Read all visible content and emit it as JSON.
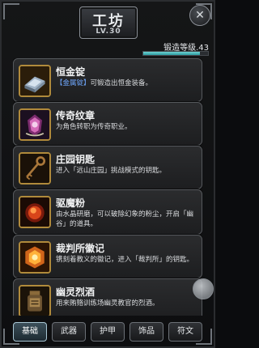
{
  "header": {
    "title": "工坊",
    "subtitle": "LV.30",
    "close_icon": "close-icon"
  },
  "level": {
    "label": "锻造等级.43",
    "progress_fraction": 0.88
  },
  "items": [
    {
      "name": "恒金锭",
      "desc_parts": [
        "",
        "【金属锭】",
        "可锻造出恒金装备。"
      ],
      "icon": "metal-ingot-icon"
    },
    {
      "name": "传奇纹章",
      "desc_parts": [
        "为角色转职为传奇职业。"
      ],
      "icon": "legend-crest-icon"
    },
    {
      "name": "庄园钥匙",
      "desc_parts": [
        "进入「远山庄园」挑战模式的钥匙。"
      ],
      "icon": "key-icon"
    },
    {
      "name": "驱魔粉",
      "desc_parts": [
        "由水晶研磨，可以破除幻象的粉尘，开启「幽谷」的道具。"
      ],
      "icon": "powder-icon"
    },
    {
      "name": "裁判所徽记",
      "desc_parts": [
        "镌刻着教义的徽记，进入「裁判所」的钥匙。"
      ],
      "icon": "emblem-icon"
    },
    {
      "name": "幽灵烈酒",
      "desc_parts": [
        "用来贿赂训练场幽灵教官的烈酒。"
      ],
      "icon": "spirit-bottle-icon"
    }
  ],
  "tabs": [
    {
      "label": "基础",
      "active": true
    },
    {
      "label": "武器",
      "active": false
    },
    {
      "label": "护甲",
      "active": false
    },
    {
      "label": "饰品",
      "active": false
    },
    {
      "label": "符文",
      "active": false
    }
  ]
}
